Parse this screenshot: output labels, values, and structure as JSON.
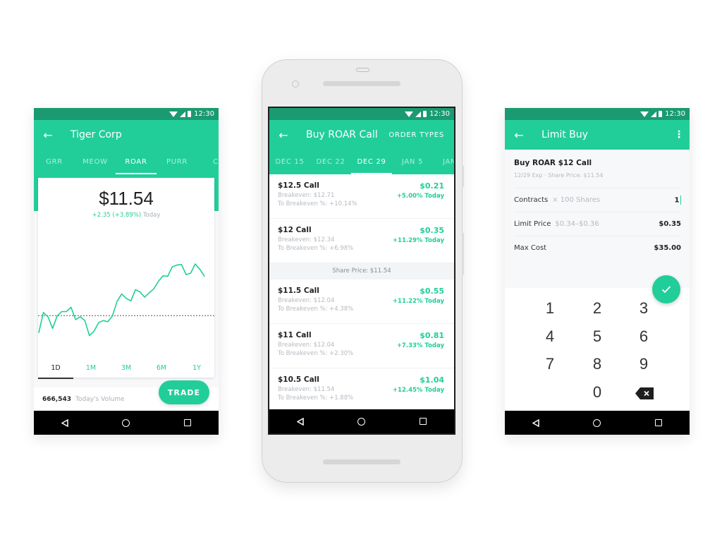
{
  "theme": {
    "accent": "#21ce99",
    "statusbar": "#1b9a72",
    "navbar": "#000000"
  },
  "status": {
    "time": "12:30",
    "icons": [
      "wifi-icon",
      "signal-icon",
      "battery-icon"
    ]
  },
  "left_screen": {
    "title": "Tiger Corp",
    "back_icon": "arrow-left-icon",
    "tabs": [
      {
        "label": "GRR",
        "active": false
      },
      {
        "label": "MEOW",
        "active": false
      },
      {
        "label": "ROAR",
        "active": true
      },
      {
        "label": "PURR",
        "active": false
      },
      {
        "label": "CA",
        "active": false
      }
    ],
    "price": "$11.54",
    "change": "+2.35 (+3.89%)",
    "change_label": "Today",
    "ranges": [
      {
        "label": "1D",
        "active": true
      },
      {
        "label": "1M",
        "active": false
      },
      {
        "label": "3M",
        "active": false
      },
      {
        "label": "6M",
        "active": false
      },
      {
        "label": "1Y",
        "active": false
      }
    ],
    "volume": "666,543",
    "volume_label": "Today's Volume",
    "trade_button": "TRADE"
  },
  "chart_data": {
    "type": "line",
    "title": "",
    "xlabel": "",
    "ylabel": "",
    "reference_line": "previous close (dotted)",
    "reference_value": 9.19,
    "ylim": [
      8.0,
      12.2
    ],
    "values": [
      8.6,
      9.3,
      9.15,
      8.75,
      9.18,
      9.33,
      9.33,
      9.48,
      9.05,
      9.15,
      9.02,
      8.5,
      8.65,
      8.95,
      9.02,
      8.98,
      9.18,
      9.68,
      9.94,
      9.79,
      9.7,
      10.09,
      10.01,
      9.83,
      9.98,
      10.12,
      10.38,
      10.57,
      10.55,
      10.88,
      10.94,
      10.96,
      10.61,
      10.66,
      10.98,
      10.79,
      10.55
    ],
    "series_color": "#21ce99",
    "grid": false
  },
  "center_screen": {
    "title": "Buy ROAR Call",
    "action": "ORDER TYPES",
    "tabs": [
      {
        "label": "DEC 15",
        "active": false
      },
      {
        "label": "DEC 22",
        "active": false
      },
      {
        "label": "DEC 29",
        "active": true
      },
      {
        "label": "JAN 5",
        "active": false
      },
      {
        "label": "JAN",
        "active": false
      }
    ],
    "options_above": [
      {
        "name": "$12.5 Call",
        "breakeven": "Breakeven: $12.71",
        "to_breakeven": "To Breakeven %: +10.14%",
        "price": "$0.21",
        "change": "+5.00% Today"
      },
      {
        "name": "$12 Call",
        "breakeven": "Breakeven: $12.34",
        "to_breakeven": "To Breakeven %: +6.98%",
        "price": "$0.35",
        "change": "+11.29% Today"
      }
    ],
    "share_price": "Share Price: $11.54",
    "options_below": [
      {
        "name": "$11.5 Call",
        "breakeven": "Breakeven: $12.04",
        "to_breakeven": "To Breakeven %: +4.38%",
        "price": "$0.55",
        "change": "+11.22% Today"
      },
      {
        "name": "$11 Call",
        "breakeven": "Breakeven: $12.04",
        "to_breakeven": "To Breakeven %: +2.30%",
        "price": "$0.81",
        "change": "+7.33% Today"
      },
      {
        "name": "$10.5 Call",
        "breakeven": "Breakeven: $11.54",
        "to_breakeven": "To Breakeven %: +1.88%",
        "price": "$1.04",
        "change": "+12.45% Today"
      }
    ]
  },
  "right_screen": {
    "title": "Limit Buy",
    "order_title": "Buy ROAR $12 Call",
    "order_sub": "12/29 Exp · Share Price: $11.54",
    "fields": [
      {
        "label": "Contracts",
        "hint": "× 100 Shares",
        "value": "1"
      },
      {
        "label": "Limit Price",
        "hint": "$0.34–$0.36",
        "value": "$0.35"
      },
      {
        "label": "Max Cost",
        "hint": "",
        "value": "$35.00"
      }
    ],
    "confirm_icon": "check-icon",
    "keys": [
      "1",
      "2",
      "3",
      "4",
      "5",
      "6",
      "7",
      "8",
      "9",
      "0"
    ],
    "backspace_icon": "backspace-icon"
  }
}
